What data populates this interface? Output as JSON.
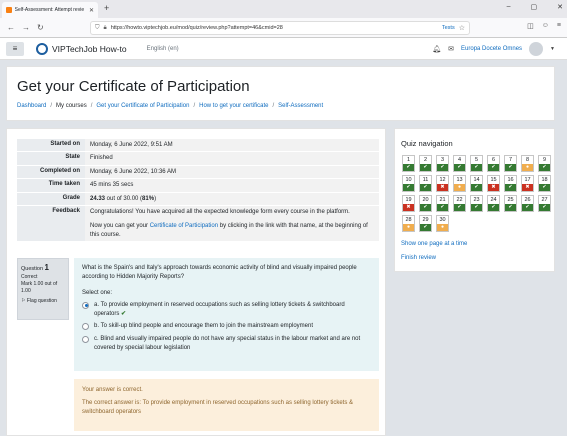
{
  "browser": {
    "tab_title": "Self-Assessment: Attempt revie",
    "url": "https://howto.viptechjob.eu/mod/quiz/review.php?attempt=46&cmid=28",
    "tests_label": "Tests"
  },
  "header": {
    "brand": "VIPTechJob How-to",
    "language": "English (en)",
    "user_name": "Europa Docete Omnes"
  },
  "page": {
    "title": "Get your Certificate of Participation",
    "breadcrumb": [
      "Dashboard",
      "My courses",
      "Get your Certificate of Participation",
      "How to get your certificate",
      "Self-Assessment"
    ]
  },
  "summary": {
    "started_label": "Started on",
    "started_value": "Monday, 6 June 2022, 9:51 AM",
    "state_label": "State",
    "state_value": "Finished",
    "completed_label": "Completed on",
    "completed_value": "Monday, 6 June 2022, 10:36 AM",
    "time_label": "Time taken",
    "time_value": "45 mins 35 secs",
    "grade_label": "Grade",
    "grade_score": "24.33",
    "grade_mid": " out of 30.00 (",
    "grade_pct": "81%",
    "grade_end": ")",
    "feedback_label": "Feedback",
    "feedback_line1": "Congratulations! You have acquired all the expected knowledge form every course in the platform.",
    "feedback_line2_pre": "Now you can get your ",
    "feedback_line2_link": "Certificate of Participation",
    "feedback_line2_post": " by clicking in the link with that name, at the beginning of this course."
  },
  "question": {
    "label": "Question",
    "number": "1",
    "status": "Correct",
    "mark": "Mark 1.00 out of 1.00",
    "flag": "Flag question",
    "text": "What is the Spain's and Italy's approach towards economic activity of blind and visually impaired people according to Hidden Majority Reports?",
    "select_one": "Select one:",
    "answers": [
      "a. To provide employment in reserved occupations such as selling lottery tickets & switchboard operators",
      "b. To skill-up blind people and encourage them to join the mainstream employment",
      "c. Blind and visually impaired people do not have any special status in the labour market and are not covered by special labour legislation"
    ],
    "selected_index": 0,
    "feedback_correct": "Your answer is correct.",
    "correct_answer": "The correct answer is: To provide employment in reserved occupations such as selling lottery tickets & switchboard operators"
  },
  "quiz_nav": {
    "title": "Quiz navigation",
    "buttons": [
      {
        "n": "1",
        "s": "c"
      },
      {
        "n": "2",
        "s": "c"
      },
      {
        "n": "3",
        "s": "c"
      },
      {
        "n": "4",
        "s": "c"
      },
      {
        "n": "5",
        "s": "c"
      },
      {
        "n": "6",
        "s": "c"
      },
      {
        "n": "7",
        "s": "c"
      },
      {
        "n": "8",
        "s": "p"
      },
      {
        "n": "9",
        "s": "c"
      },
      {
        "n": "10",
        "s": "c"
      },
      {
        "n": "11",
        "s": "c"
      },
      {
        "n": "12",
        "s": "i"
      },
      {
        "n": "13",
        "s": "p"
      },
      {
        "n": "14",
        "s": "c"
      },
      {
        "n": "15",
        "s": "i"
      },
      {
        "n": "16",
        "s": "c"
      },
      {
        "n": "17",
        "s": "i"
      },
      {
        "n": "18",
        "s": "c"
      },
      {
        "n": "19",
        "s": "i"
      },
      {
        "n": "20",
        "s": "c"
      },
      {
        "n": "21",
        "s": "c"
      },
      {
        "n": "22",
        "s": "c"
      },
      {
        "n": "23",
        "s": "c"
      },
      {
        "n": "24",
        "s": "c"
      },
      {
        "n": "25",
        "s": "c"
      },
      {
        "n": "26",
        "s": "c"
      },
      {
        "n": "27",
        "s": "c"
      },
      {
        "n": "28",
        "s": "p"
      },
      {
        "n": "29",
        "s": "c"
      },
      {
        "n": "30",
        "s": "p"
      }
    ],
    "show_one_page": "Show one page at a time",
    "finish_review": "Finish review"
  },
  "colors": {
    "correct": "#357a32",
    "incorrect": "#ca3120",
    "partial": "#f0ad4e",
    "link": "#0f6cbf"
  },
  "icons": {
    "correct_mark": "✔",
    "incorrect_mark": "✖",
    "partial_mark": "●"
  }
}
